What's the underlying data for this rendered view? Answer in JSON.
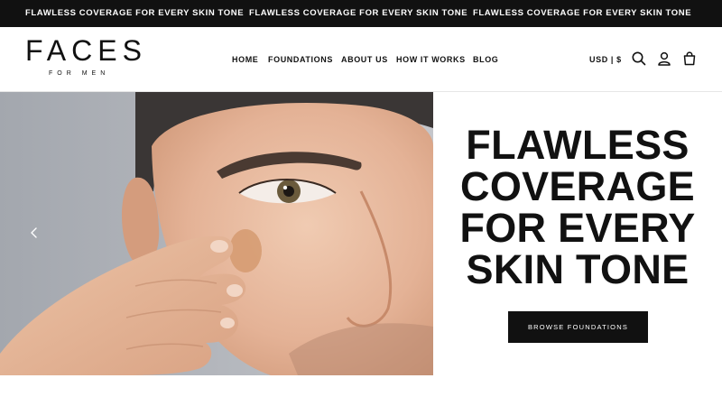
{
  "announcement": {
    "messages": [
      "FLAWLESS COVERAGE FOR EVERY SKIN TONE",
      "FLAWLESS COVERAGE FOR EVERY SKIN TONE",
      "FLAWLESS COVERAGE FOR EVERY SKIN TONE"
    ]
  },
  "header": {
    "logo": {
      "main": "FACES",
      "sub": "FOR MEN"
    },
    "nav": [
      {
        "label": "HOME"
      },
      {
        "label": "FOUNDATIONS"
      },
      {
        "label": "ABOUT US"
      },
      {
        "label": "HOW IT WORKS"
      },
      {
        "label": "BLOG"
      }
    ],
    "currency": "USD | $",
    "icons": [
      "search-icon",
      "account-icon",
      "cart-icon"
    ]
  },
  "hero": {
    "headline_lines": [
      "FLAWLESS",
      "COVERAGE",
      "FOR EVERY",
      "SKIN TONE"
    ],
    "cta_label": "BROWSE FOUNDATIONS",
    "prev_icon": "chevron-left-icon"
  },
  "colors": {
    "announcement_bg": "#111111",
    "announcement_text": "#ffffff",
    "cta_bg": "#111111",
    "cta_text": "#ffffff",
    "text": "#111111"
  }
}
